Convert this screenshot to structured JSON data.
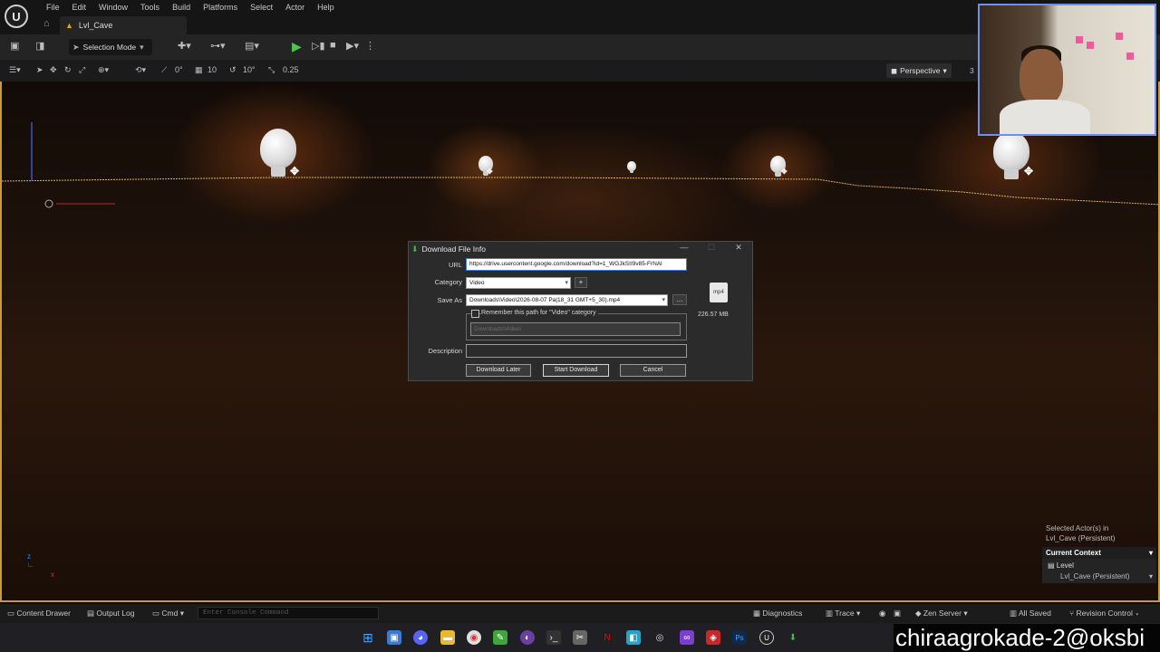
{
  "menu": {
    "logo": "U",
    "items": [
      "File",
      "Edit",
      "Window",
      "Tools",
      "Build",
      "Platforms",
      "Select",
      "Actor",
      "Help"
    ]
  },
  "tabs": {
    "level_tab": "Lvl_Cave"
  },
  "toolbar": {
    "selection_mode": "Selection Mode"
  },
  "viewport_toolbar": {
    "angle_snap": "0°",
    "grid_snap": "10",
    "rotation_snap": "10°",
    "scale_snap": "0.25",
    "perspective": "Perspective",
    "extra": "3"
  },
  "dialog": {
    "title": "Download File Info",
    "url_label": "URL",
    "url_value": "https://drive.usercontent.google.com/download?id=1_WGJkSII9v85-FrNAl",
    "category_label": "Category",
    "category_value": "Video",
    "add_category": "+",
    "save_as_label": "Save As",
    "save_as_value": "Downloads\\Video\\2026-08-07 Pa|18_31 GMT+5_30).mp4",
    "browse": "...",
    "remember_label": "Remember this path for \"Video\" category",
    "remember_path": "Downloads\\Video\\",
    "description_label": "Description",
    "download_later": "Download Later",
    "start_download": "Start Download",
    "cancel": "Cancel",
    "file_type": "mp4",
    "file_size": "226.57 MB"
  },
  "actor_panel": {
    "selected": "Selected Actor(s) in",
    "selected_level": "Lvl_Cave (Persistent)",
    "current_context": "Current Context",
    "level_label": "Level",
    "level_value": "Lvl_Cave (Persistent)"
  },
  "statusbar": {
    "content_drawer": "Content Drawer",
    "output_log": "Output Log",
    "cmd": "Cmd",
    "console_placeholder": "Enter Console Command",
    "diagnostics": "Diagnostics",
    "trace": "Trace",
    "zen_server": "Zen Server",
    "all_saved": "All Saved",
    "revision_control": "Revision Control"
  },
  "watermark": "chiraagrokade-2@oksbi",
  "colors": {
    "accent": "#c89a3a",
    "play": "#4fc24f",
    "webcam_border": "#6d8ff0"
  }
}
